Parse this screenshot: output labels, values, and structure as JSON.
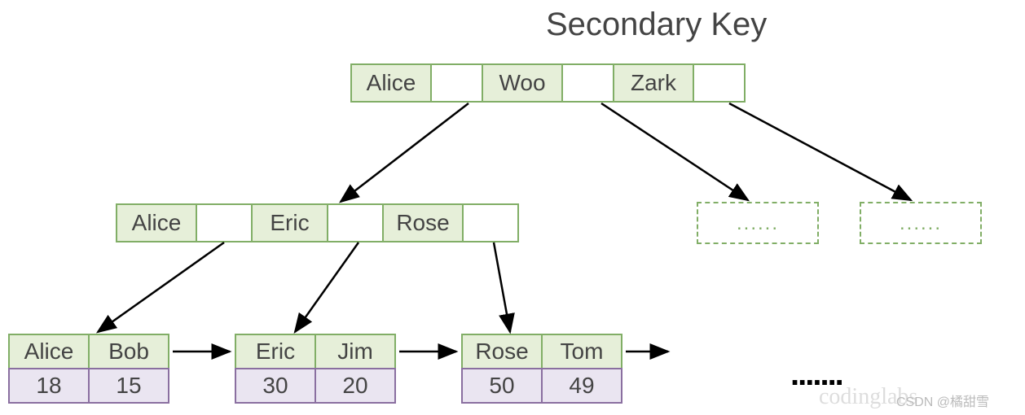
{
  "title": "Secondary Key",
  "root": {
    "keys": [
      "Alice",
      "Woo",
      "Zark"
    ]
  },
  "internal_level2": {
    "keys": [
      "Alice",
      "Eric",
      "Rose"
    ]
  },
  "leaf1": {
    "keys": [
      "Alice",
      "Bob"
    ],
    "vals": [
      "18",
      "15"
    ]
  },
  "leaf2": {
    "keys": [
      "Eric",
      "Jim"
    ],
    "vals": [
      "30",
      "20"
    ]
  },
  "leaf3": {
    "keys": [
      "Rose",
      "Tom"
    ],
    "vals": [
      "50",
      "49"
    ]
  },
  "dashed_placeholder": "......",
  "ellipsis": ".......",
  "watermark": "codinglabs",
  "csdn": "CSDN @橘甜雪"
}
